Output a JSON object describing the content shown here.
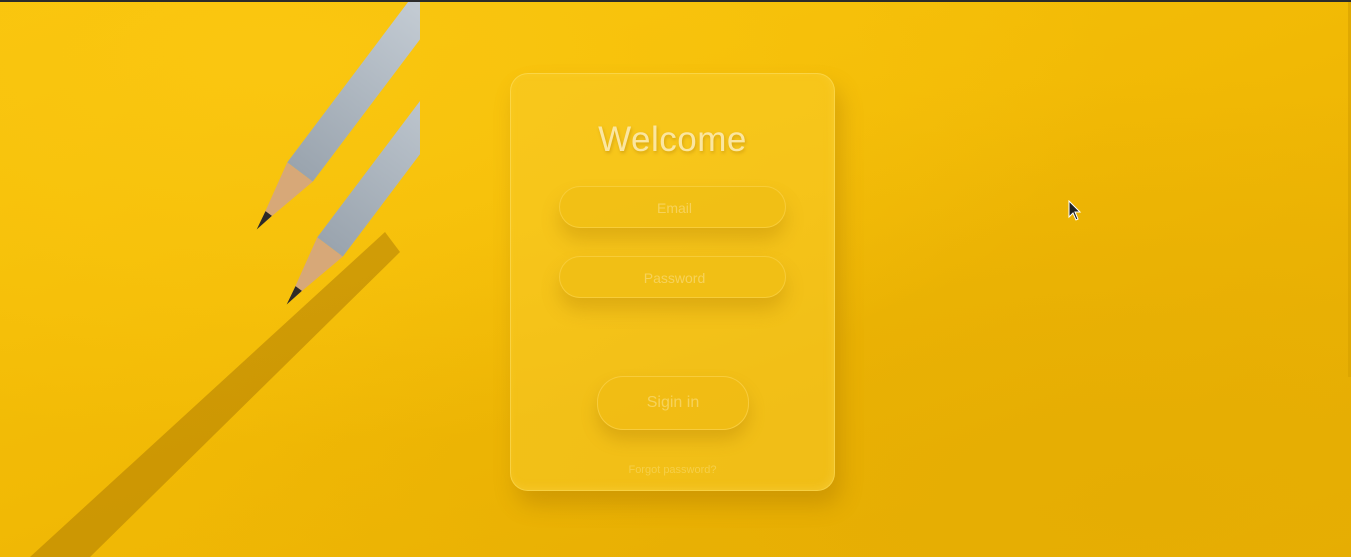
{
  "login": {
    "title": "Welcome",
    "email_placeholder": "Email",
    "password_placeholder": "Password",
    "signin_label": "Sigin in",
    "forgot_label": "Forgot password?"
  },
  "icons": {
    "background": "pencils-image",
    "cursor": "mouse-pointer-icon"
  },
  "colors": {
    "background": "#f2bc05",
    "card": "#f8ca28",
    "text": "#fbe6a0"
  }
}
